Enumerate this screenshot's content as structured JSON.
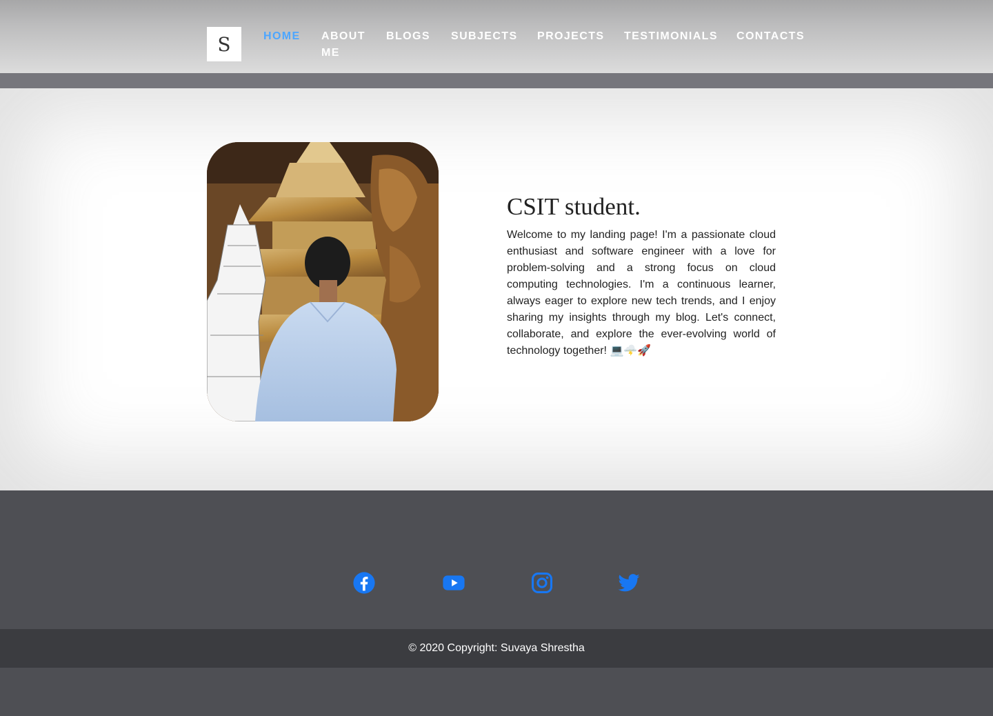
{
  "header": {
    "logo_letter": "S",
    "nav": [
      {
        "label": "HOME",
        "active": true
      },
      {
        "label": "ABOUT",
        "label_line2": "ME"
      },
      {
        "label": "BLOGS"
      },
      {
        "label": "SUBJECTS"
      },
      {
        "label": "PROJECTS"
      },
      {
        "label": "TESTIMONIALS"
      },
      {
        "label": "CONTACTS"
      }
    ]
  },
  "hero": {
    "title": "CSIT student.",
    "description": "Welcome to my landing page! I'm a passionate cloud enthusiast and software engineer with a love for problem-solving and a strong focus on cloud computing technologies. I'm a continuous learner, always eager to explore new tech trends, and I enjoy sharing my insights through my blog. Let's connect, collaborate, and explore the ever-evolving world of technology together! 💻🌩️🚀"
  },
  "social": {
    "icons": [
      "facebook-icon",
      "youtube-icon",
      "instagram-icon",
      "twitter-icon"
    ],
    "color": "#1877f2"
  },
  "footer": {
    "copyright": "© 2020 Copyright: Suvaya Shrestha"
  },
  "colors": {
    "accent": "#4da6ff",
    "footer_bg": "#3b3c40",
    "page_bg": "#4e4f54"
  }
}
